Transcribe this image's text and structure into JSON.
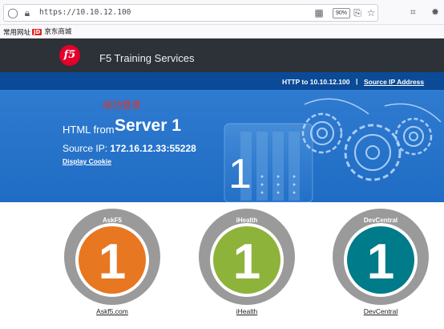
{
  "browser": {
    "url": "https://10.10.12.100",
    "zoom": "90%",
    "bookmarks": [
      {
        "label": "常用网址"
      },
      {
        "label": "京东商城",
        "badge": "JD"
      }
    ]
  },
  "header": {
    "logo_text": "f5",
    "brand": "F5 Training Services"
  },
  "infobar": {
    "connection": "HTTP to 10.10.12.100",
    "separator": "|",
    "source_link": "Source IP Address"
  },
  "hero": {
    "status_cn": "成功登录",
    "html_from": "HTML from",
    "server": "Server 1",
    "source_label": "Source IP:",
    "source_value": "172.16.12.33:55228",
    "cookie_link": "Display Cookie",
    "big_number": "1"
  },
  "badges": [
    {
      "ring_label": "AskF5",
      "number": "1",
      "link": "Askf5.com",
      "color": "#e87722"
    },
    {
      "ring_label": "iHealth",
      "number": "1",
      "link": "iHealth",
      "color": "#8db33a"
    },
    {
      "ring_label": "DevCentral",
      "number": "1",
      "link": "DevCentral",
      "color": "#007b8a"
    }
  ],
  "colors": {
    "topbar": "#2d3138",
    "infobar": "#0b4a97",
    "hero": "#2a75cc",
    "ring": "#9a9a9a"
  }
}
